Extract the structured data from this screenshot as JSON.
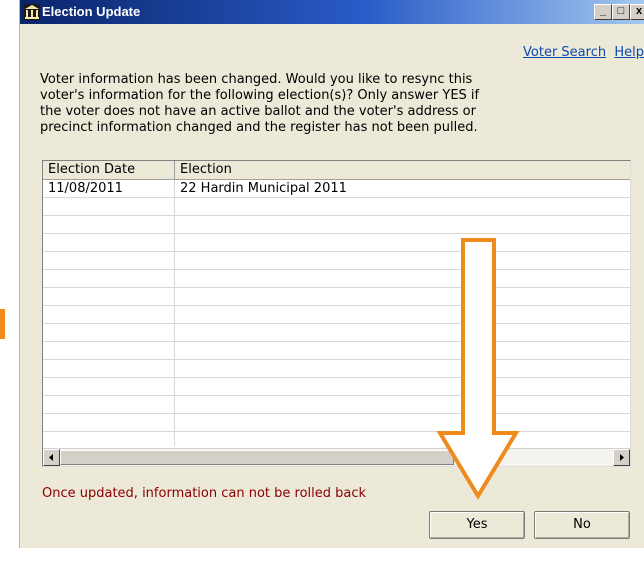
{
  "window": {
    "title": "Election Update",
    "controls": {
      "minimize": "_",
      "maximize": "□",
      "close": "x"
    }
  },
  "links": {
    "voter_search": "Voter Search",
    "help": "Help"
  },
  "message": {
    "lines": [
      "Voter information has been changed. Would you like to resync this",
      "voter's information for the following election(s)?  Only answer YES if",
      "the voter does not have an active ballot and the voter's address or",
      "precinct information changed and the register has not been pulled."
    ]
  },
  "table": {
    "columns": [
      "Election Date",
      "Election"
    ],
    "rows": [
      {
        "date": "11/08/2011",
        "election": "22 Hardin Municipal 2011"
      }
    ]
  },
  "warning": "Once updated, information can not be rolled back",
  "buttons": {
    "yes": "Yes",
    "no": "No"
  },
  "colors": {
    "annotation_arrow": "#f08a1c",
    "warning_text": "#8b0000",
    "link": "#0b49b0"
  }
}
